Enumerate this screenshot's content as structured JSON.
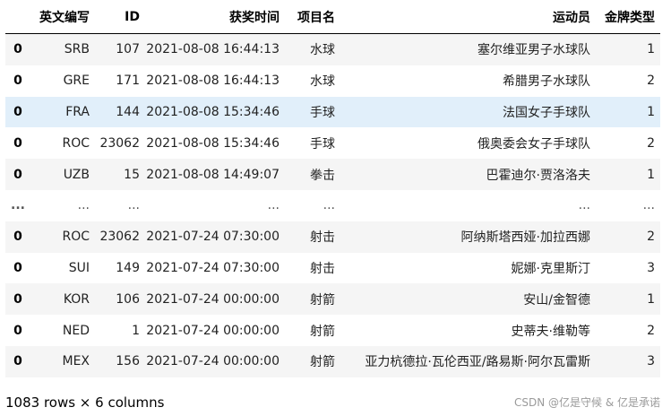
{
  "table": {
    "columns": [
      "",
      "英文编写",
      "ID",
      "获奖时间",
      "项目名",
      "运动员",
      "金牌类型"
    ],
    "rows": [
      {
        "index": "0",
        "code": "SRB",
        "id": "107",
        "time": "2021-08-08 16:44:13",
        "event": "水球",
        "athlete": "塞尔维亚男子水球队",
        "medal": "1"
      },
      {
        "index": "0",
        "code": "GRE",
        "id": "171",
        "time": "2021-08-08 16:44:13",
        "event": "水球",
        "athlete": "希腊男子水球队",
        "medal": "2"
      },
      {
        "index": "0",
        "code": "FRA",
        "id": "144",
        "time": "2021-08-08 15:34:46",
        "event": "手球",
        "athlete": "法国女子手球队",
        "medal": "1"
      },
      {
        "index": "0",
        "code": "ROC",
        "id": "23062",
        "time": "2021-08-08 15:34:46",
        "event": "手球",
        "athlete": "俄奥委会女子手球队",
        "medal": "2"
      },
      {
        "index": "0",
        "code": "UZB",
        "id": "15",
        "time": "2021-08-08 14:49:07",
        "event": "拳击",
        "athlete": "巴霍迪尔·贾洛洛夫",
        "medal": "1"
      },
      {
        "index": "...",
        "code": "...",
        "id": "...",
        "time": "...",
        "event": "...",
        "athlete": "...",
        "medal": "..."
      },
      {
        "index": "0",
        "code": "ROC",
        "id": "23062",
        "time": "2021-07-24 07:30:00",
        "event": "射击",
        "athlete": "阿纳斯塔西娅·加拉西娜",
        "medal": "2"
      },
      {
        "index": "0",
        "code": "SUI",
        "id": "149",
        "time": "2021-07-24 07:30:00",
        "event": "射击",
        "athlete": "妮娜·克里斯汀",
        "medal": "3"
      },
      {
        "index": "0",
        "code": "KOR",
        "id": "106",
        "time": "2021-07-24 00:00:00",
        "event": "射箭",
        "athlete": "安山/金智德",
        "medal": "1"
      },
      {
        "index": "0",
        "code": "NED",
        "id": "1",
        "time": "2021-07-24 00:00:00",
        "event": "射箭",
        "athlete": "史蒂夫·维勒等",
        "medal": "2"
      },
      {
        "index": "0",
        "code": "MEX",
        "id": "156",
        "time": "2021-07-24 00:00:00",
        "event": "射箭",
        "athlete": "亚力杭德拉·瓦伦西亚/路易斯·阿尔瓦雷斯",
        "medal": "3"
      }
    ]
  },
  "footer": {
    "shape": "1083 rows × 6 columns"
  },
  "watermark": {
    "text": "CSDN @亿是守候 & 亿是承诺"
  },
  "colors": {
    "hover_row": "#e1effa",
    "striped_row": "#f5f5f5",
    "header_border": "#000000"
  }
}
